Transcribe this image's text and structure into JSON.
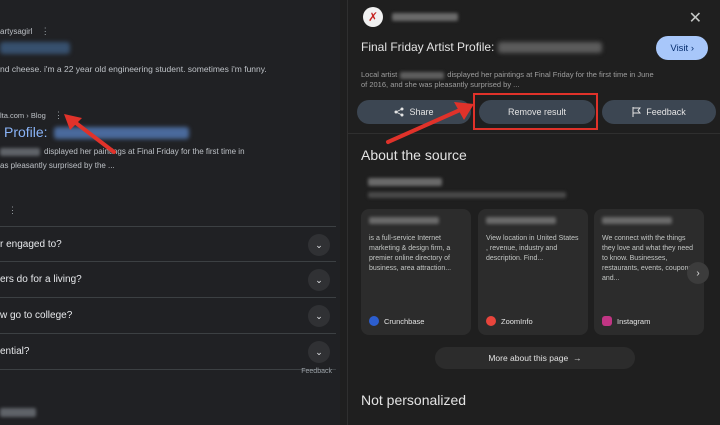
{
  "left": {
    "result1": {
      "source": "artysagirl",
      "snippet": "nd cheese. i'm a 22 year old engineering student. sometimes i'm funny."
    },
    "result2": {
      "source": "lta.com › Blog",
      "title": "Profile:",
      "snippet_line1": "displayed her paintings at Final Friday for the first time in",
      "snippet_line2": "as pleasantly surprised by the ..."
    },
    "people_also_ask": [
      "r engaged to?",
      "ers do for a living?",
      "w go to college?",
      "ential?"
    ],
    "feedback_label": "Feedback"
  },
  "panel": {
    "title_prefix": "Final Friday Artist Profile:",
    "visit_label": "Visit",
    "desc_line1_a": "Local artist",
    "desc_line1_b": "displayed her paintings at Final Friday for the first time in June",
    "desc_line2": "of 2016, and she was pleasantly surprised by ...",
    "actions": {
      "share": "Share",
      "remove": "Remove result",
      "feedback": "Feedback"
    },
    "about_heading": "About the source",
    "cards": [
      {
        "text": "is a full-service Internet marketing & design firm, a premier online directory of business, area attraction...",
        "source": "Crunchbase"
      },
      {
        "text": "View location in United States , revenue, industry and description. Find...",
        "source": "ZoomInfo"
      },
      {
        "text": "We connect with the things they love and what they need to know. Businesses, restaurants, events, coupons and...",
        "source": "Instagram"
      }
    ],
    "more_label": "More about this page",
    "not_personalized": "Not personalized"
  },
  "icons": {
    "close": "close-icon",
    "share": "share-icon",
    "feedback": "flag-icon",
    "next": "chevron-right-icon",
    "chevron": "chevron-down-icon",
    "kebab": "more-vert-icon"
  },
  "colors": {
    "accent": "#a8c7fa",
    "highlight": "#e0322a",
    "link": "#8ab4f8"
  }
}
